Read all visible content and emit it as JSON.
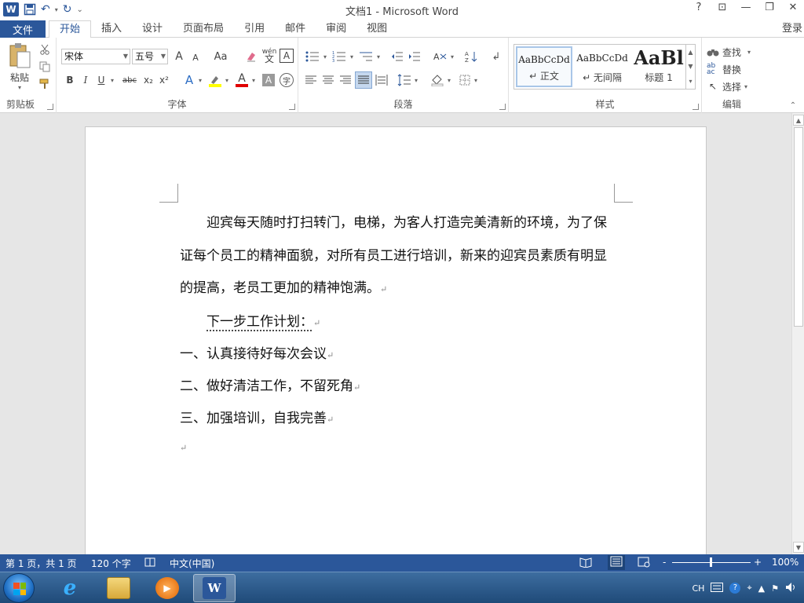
{
  "window": {
    "title": "文档1 - Microsoft Word",
    "app_badge": "W",
    "help": "?",
    "controls": {
      "ribbon_display": "⊡",
      "minimize": "—",
      "restore": "❐",
      "close": "✕"
    }
  },
  "qat": {
    "save_icon": "save-icon",
    "undo_glyph": "↶",
    "redo_glyph": "↻",
    "customize_glyph": "⌄"
  },
  "tabs": {
    "file": "文件",
    "items": [
      "开始",
      "插入",
      "设计",
      "页面布局",
      "引用",
      "邮件",
      "审阅",
      "视图"
    ],
    "active": "开始",
    "signin": "登录"
  },
  "ribbon": {
    "clipboard": {
      "label": "剪贴板",
      "paste": "粘贴"
    },
    "font": {
      "label": "字体",
      "font_name": "宋体",
      "font_size": "五号",
      "grow": "A",
      "shrink": "A",
      "case": "Aa",
      "phonetic": "wén",
      "bold": "B",
      "italic": "I",
      "underline": "U",
      "strike": "abc",
      "subscript": "x₂",
      "superscript": "x²",
      "effects": "A",
      "font_color": "A",
      "shading": "A",
      "enclose": "字"
    },
    "paragraph": {
      "label": "段落"
    },
    "styles": {
      "label": "样式",
      "items": [
        {
          "sample": "AaBbCcDd",
          "name": "↵ 正文"
        },
        {
          "sample": "AaBbCcDd",
          "name": "↵ 无间隔"
        },
        {
          "sample": "AaBl",
          "name": "标题 1"
        }
      ]
    },
    "editing": {
      "label": "编辑",
      "find": "查找",
      "replace": "替换",
      "select": "选择"
    }
  },
  "document": {
    "paragraph1": "迎宾每天随时打扫转门，电梯，为客人打造完美清新的环境，为了保证每个员工的精神面貌，对所有员工进行培训，新来的迎宾员素质有明显的提高，老员工更加的精神饱满。",
    "line_heading": "下一步工作计划：",
    "item1": "一、认真接待好每次会议",
    "item2": "二、做好清洁工作，不留死角",
    "item3": "三、加强培训，自我完善",
    "para_mark": "↵"
  },
  "status": {
    "page": "第 1 页，共 1 页",
    "words": "120 个字",
    "language": "中文(中国)",
    "zoom_minus": "-",
    "zoom_plus": "+",
    "zoom": "100%",
    "zoom_value": 1.0
  },
  "taskbar": {
    "apps": [
      "ie",
      "explorer",
      "media-player",
      "word"
    ],
    "word_glyph": "W",
    "tray_lang": "CH"
  },
  "colors": {
    "accent": "#2b579a"
  }
}
